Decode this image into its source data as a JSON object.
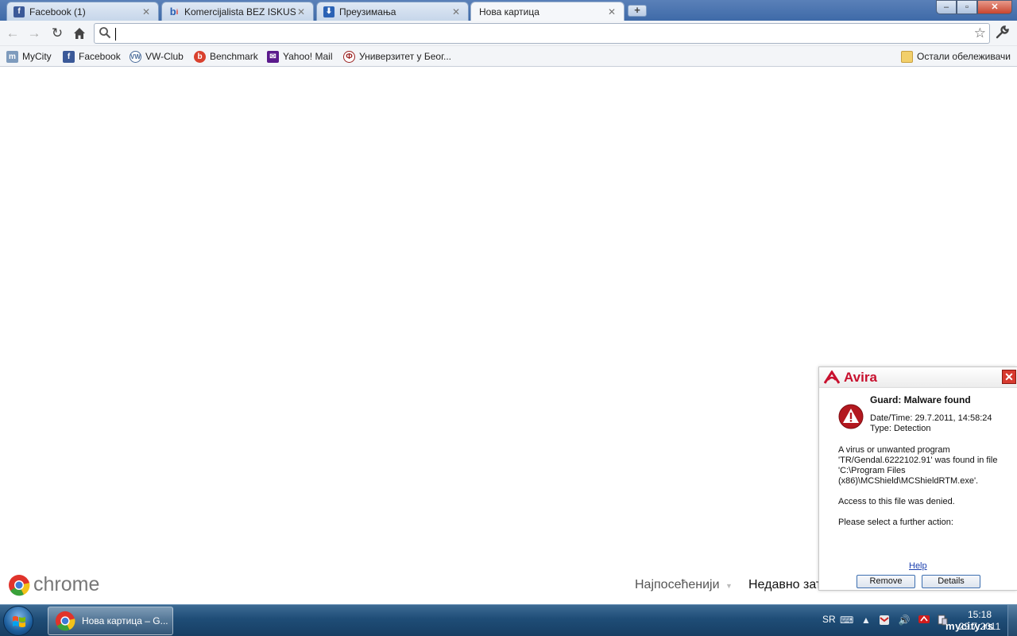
{
  "browser": {
    "tabs": [
      {
        "title": "Facebook (1)",
        "favicon": "facebook-icon",
        "active": false
      },
      {
        "title": "Komercijalista BEZ ISKUSTV",
        "favicon": "b-icon",
        "active": false
      },
      {
        "title": "Преузимања",
        "favicon": "download-icon",
        "active": false
      },
      {
        "title": "Нова картица",
        "favicon": "",
        "active": true
      }
    ],
    "new_tab_label": "+",
    "window_controls": {
      "minimize": "–",
      "maximize": "▫",
      "close": "✕"
    },
    "omnibox": {
      "value": "",
      "placeholder": ""
    },
    "bookmarks": [
      {
        "label": "MyCity",
        "icon": "mycity-icon"
      },
      {
        "label": "Facebook",
        "icon": "facebook-icon"
      },
      {
        "label": "VW-Club",
        "icon": "vw-icon"
      },
      {
        "label": "Benchmark",
        "icon": "benchmark-icon"
      },
      {
        "label": "Yahoo! Mail",
        "icon": "yahoo-mail-icon"
      },
      {
        "label": "Универзитет у Беог...",
        "icon": "university-icon"
      }
    ],
    "other_bookmarks": "Остали обележивачи"
  },
  "ntp": {
    "logo_text": "chrome",
    "most_visited": "Најпосећенији",
    "most_visited_arrow": "▼",
    "recently_closed": "Недавно зат"
  },
  "avira": {
    "brand": "Avira",
    "close": "✕",
    "heading": "Guard: Malware found",
    "datetime": "Date/Time: 29.7.2011, 14:58:24",
    "type": "Type: Detection",
    "message_lines": [
      "A virus or unwanted program",
      "'TR/Gendal.6222102.91' was found in file",
      "'C:\\Program Files",
      "(x86)\\MCShield\\MCShieldRTM.exe'."
    ],
    "access": "Access to this file was denied.",
    "prompt": "Please select a further action:",
    "help": "Help",
    "remove": "Remove",
    "details": "Details"
  },
  "taskbar": {
    "task_label": "Нова картица – G...",
    "lang": "SR",
    "time": "15:18",
    "date": "29.7.2011",
    "watermark": "mycity.rs"
  },
  "colors": {
    "facebook": "#3b5998",
    "avira_red": "#c8102e",
    "taskbar": "#1f4d77"
  }
}
